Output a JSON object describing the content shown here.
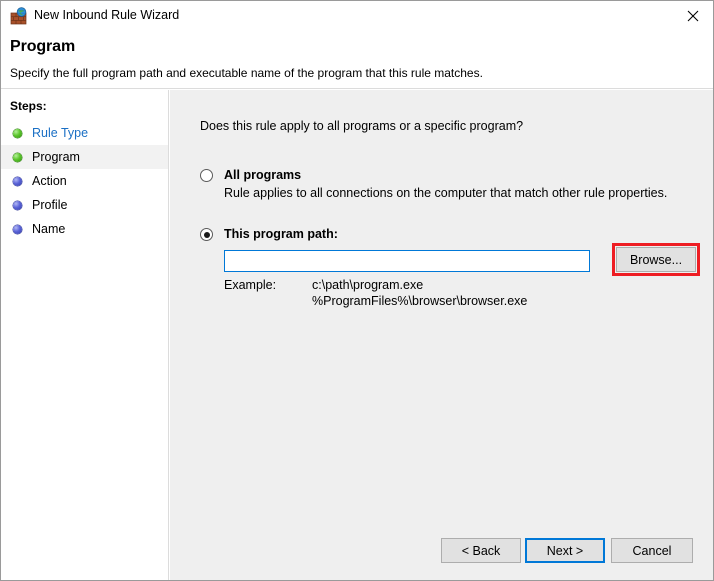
{
  "window": {
    "title": "New Inbound Rule Wizard",
    "icon": "firewall-icon",
    "close_label": "✕"
  },
  "header": {
    "title": "Program",
    "subtitle": "Specify the full program path and executable name of the program that this rule matches."
  },
  "sidebar": {
    "heading": "Steps:",
    "items": [
      {
        "label": "Rule Type",
        "state": "done",
        "style": "link",
        "current": false
      },
      {
        "label": "Program",
        "state": "done",
        "style": "plain",
        "current": true
      },
      {
        "label": "Action",
        "state": "pending",
        "style": "plain",
        "current": false
      },
      {
        "label": "Profile",
        "state": "pending",
        "style": "plain",
        "current": false
      },
      {
        "label": "Name",
        "state": "pending",
        "style": "plain",
        "current": false
      }
    ]
  },
  "main": {
    "question": "Does this rule apply to all programs or a specific program?",
    "options": [
      {
        "label": "All programs",
        "description": "Rule applies to all connections on the computer that match other rule properties.",
        "selected": false
      },
      {
        "label": "This program path:",
        "selected": true
      }
    ],
    "path_input": {
      "value": "",
      "placeholder": ""
    },
    "browse_label": "Browse...",
    "example": {
      "label": "Example:",
      "line1": "c:\\path\\program.exe",
      "line2": "%ProgramFiles%\\browser\\browser.exe"
    }
  },
  "footer": {
    "back_label": "< Back",
    "next_label": "Next >",
    "cancel_label": "Cancel"
  },
  "colors": {
    "accent_blue": "#0078d7",
    "highlight_red": "#ee1d23",
    "link_blue": "#1a6fc4",
    "step_done_green": "#5cc62c",
    "step_pending_blue": "#5b64d8",
    "main_bg": "#efefef",
    "button_bg": "#e1e1e1"
  }
}
